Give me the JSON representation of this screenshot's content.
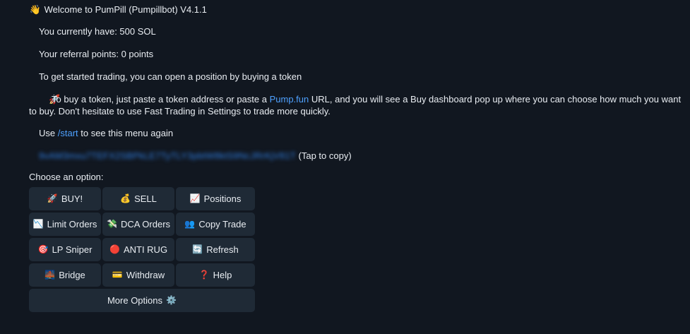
{
  "message": {
    "welcome_emoji": "👋",
    "welcome": "Welcome to PumPill (Pumpillbot) V4.1.1",
    "balance": "You currently have: 500 SOL",
    "referral": "Your referral points: 0 points",
    "get_started": "To get started trading, you can open a position by buying a token",
    "buy_info_emoji": "🚀",
    "buy_info_before": "To buy a token, just paste a token address or paste a ",
    "buy_info_link": "Pump.fun",
    "buy_info_after": " URL, and you will see a Buy dashboard pop up where you can choose how much you want to buy. Don't hesitate to use Fast Trading in Settings to trade more quickly.",
    "use_prefix": "Use ",
    "use_command": "/start",
    "use_suffix": " to see this menu again",
    "wallet_address": "9vAM3mxu7TEFX2SBPkLE7TyTLY3pbtW8ktS9NcJRrKjV81T",
    "tap_to_copy": "(Tap to copy)",
    "choose_option": "Choose an option:"
  },
  "buttons": {
    "buy": {
      "icon": "🚀",
      "icon_name": "rocket-icon",
      "label": "BUY!"
    },
    "sell": {
      "icon": "💰",
      "icon_name": "money-bag-icon",
      "label": "SELL"
    },
    "positions": {
      "icon": "📈",
      "icon_name": "chart-up-icon",
      "label": "Positions"
    },
    "limit_orders": {
      "icon": "📉",
      "icon_name": "chart-down-icon",
      "label": "Limit Orders"
    },
    "dca_orders": {
      "icon": "💸",
      "icon_name": "money-wings-icon",
      "label": "DCA Orders"
    },
    "copy_trade": {
      "icon": "👥",
      "icon_name": "people-icon",
      "label": "Copy Trade"
    },
    "lp_sniper": {
      "icon": "🎯",
      "icon_name": "target-icon",
      "label": "LP Sniper"
    },
    "anti_rug": {
      "icon": "🔴",
      "icon_name": "red-circle-icon",
      "label": "ANTI RUG"
    },
    "refresh": {
      "icon": "🔄",
      "icon_name": "refresh-icon",
      "label": "Refresh"
    },
    "bridge": {
      "icon": "🌉",
      "icon_name": "bridge-icon",
      "label": "Bridge"
    },
    "withdraw": {
      "icon": "💳",
      "icon_name": "credit-card-icon",
      "label": "Withdraw"
    },
    "help": {
      "icon": "❓",
      "icon_name": "question-mark-icon",
      "label": "Help"
    },
    "more_options": {
      "icon": "⚙️",
      "icon_name": "gear-icon",
      "label": "More Options"
    }
  },
  "colors": {
    "background": "#111720",
    "button": "#1f2a36",
    "link": "#4ea1ff",
    "text": "#e9edf2"
  }
}
